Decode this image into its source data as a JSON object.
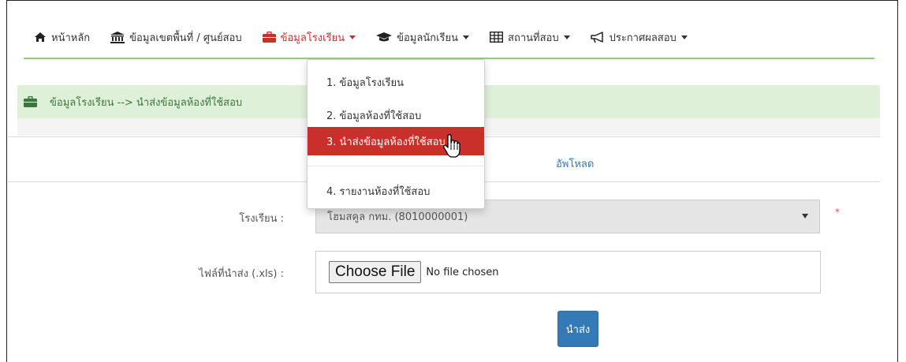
{
  "navbar": {
    "items": [
      {
        "label": "หน้าหลัก",
        "icon": "home-icon"
      },
      {
        "label": "ข้อมูลเขตพื้นที่ / ศูนย์สอบ",
        "icon": "institution-icon"
      },
      {
        "label": "ข้อมูลโรงเรียน",
        "icon": "briefcase-icon",
        "active": true
      },
      {
        "label": "ข้อมูลนักเรียน",
        "icon": "graduation-cap-icon"
      },
      {
        "label": "สถานที่สอบ",
        "icon": "table-icon"
      },
      {
        "label": "ประกาศผลสอบ",
        "icon": "bullhorn-icon"
      }
    ],
    "active_color": "#c9302c"
  },
  "breadcrumb": {
    "text": "ข้อมูลโรงเรียน --> นำส่งข้อมูลห้องที่ใช้สอบ",
    "icon": "briefcase-icon"
  },
  "tab": {
    "label": "อัพโหลด"
  },
  "dropdown": {
    "items": [
      "1. ข้อมูลโรงเรียน",
      "2. ข้อมูลห้องที่ใช้สอบ",
      "3. นำส่งข้อมูลห้องที่ใช้สอบ",
      "4. รายงานห้องที่ใช้สอบ"
    ],
    "active_index": 2
  },
  "form": {
    "school_label": "โรงเรียน :",
    "school_value": "โฮมสคูล กทม. (8010000001)",
    "required_mark": "*",
    "file_label": "ไฟล์ที่นำส่ง (.xls) :",
    "file_button": "Choose File",
    "file_status": "No file chosen",
    "submit_label": "นำส่ง"
  }
}
